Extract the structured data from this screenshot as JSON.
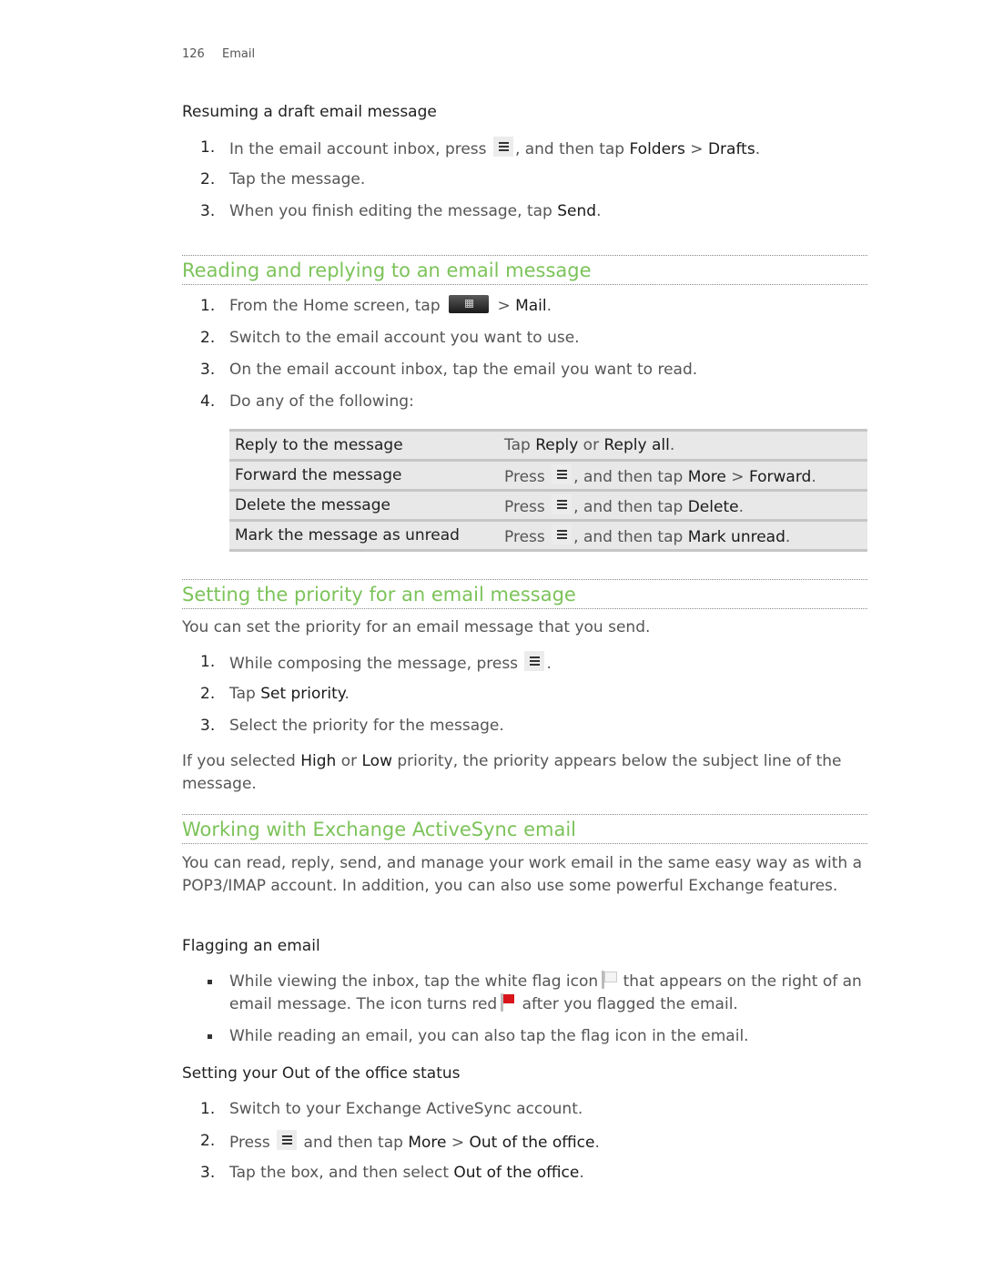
{
  "header": {
    "page_number": "126",
    "chapter": "Email"
  },
  "resume_draft": {
    "title": "Resuming a draft email message",
    "steps": [
      {
        "n": "1.",
        "a": "In the email account inbox, press",
        "icon": "menu-key-icon",
        "b": ", and then tap ",
        "c": "Folders",
        "d": " > ",
        "e": "Drafts",
        "f": "."
      },
      {
        "n": "2.",
        "text": "Tap the message."
      },
      {
        "n": "3.",
        "a": "When you finish editing the message, tap ",
        "c": "Send",
        "f": "."
      }
    ]
  },
  "reading": {
    "title": "Reading and replying to an email message",
    "steps": [
      {
        "n": "1.",
        "a": "From the Home screen, tap",
        "icon": "all-apps-icon",
        "b": "> ",
        "c": "Mail",
        "f": "."
      },
      {
        "n": "2.",
        "text": "Switch to the email account you want to use."
      },
      {
        "n": "3.",
        "text": "On the email account inbox, tap the email you want to read."
      },
      {
        "n": "4.",
        "text": "Do any of the following:"
      }
    ],
    "table": [
      {
        "action": "Reply to the message",
        "p1": "Tap ",
        "b1": "Reply",
        "p2": " or ",
        "b2": "Reply all",
        "p3": "."
      },
      {
        "action": "Forward the message",
        "p1": "Press",
        "icon": "menu-key-icon",
        "p2": ", and then tap ",
        "b1": "More",
        "p3": " > ",
        "b2": "Forward",
        "p4": "."
      },
      {
        "action": "Delete the message",
        "p1": "Press",
        "icon": "menu-key-icon",
        "p2": ", and then tap ",
        "b1": "Delete",
        "p3": "."
      },
      {
        "action": "Mark the message as unread",
        "p1": "Press",
        "icon": "menu-key-icon",
        "p2": ", and then tap ",
        "b1": "Mark unread",
        "p3": "."
      }
    ]
  },
  "priority": {
    "title": "Setting the priority for an email message",
    "intro": "You can set the priority for an email message that you send.",
    "steps": [
      {
        "n": "1.",
        "a": "While composing the message, press",
        "icon": "menu-key-icon",
        "f": "."
      },
      {
        "n": "2.",
        "a": "Tap ",
        "c": "Set priority",
        "f": "."
      },
      {
        "n": "3.",
        "text": "Select the priority for the message."
      }
    ],
    "note": {
      "a": "If you selected ",
      "b1": "High",
      "b": " or ",
      "b2": "Low",
      "c": " priority, the priority appears below the subject line of the message."
    }
  },
  "exchange": {
    "title": "Working with Exchange ActiveSync email",
    "intro": "You can read, reply, send, and manage your work email in the same easy way as with a POP3/IMAP account. In addition, you can also use some powerful Exchange features.",
    "flagging": {
      "title": "Flagging an email",
      "bullets": [
        {
          "a": "While viewing the inbox, tap the white flag icon",
          "b": "that appears on the right of an email message. The icon turns red",
          "c": "after you flagged the email."
        },
        {
          "text": "While reading an email, you can also tap the flag icon in the email."
        }
      ]
    },
    "out_of_office": {
      "title": "Setting your Out of the office status",
      "steps": [
        {
          "n": "1.",
          "text": "Switch to your Exchange ActiveSync account."
        },
        {
          "n": "2.",
          "a": "Press",
          "icon": "menu-key-icon",
          "b": " and then tap ",
          "c": "More",
          "d": " > ",
          "e": "Out of the office",
          "f": "."
        },
        {
          "n": "3.",
          "a": "Tap the box, and then select ",
          "c": "Out of the office",
          "f": "."
        }
      ]
    }
  }
}
